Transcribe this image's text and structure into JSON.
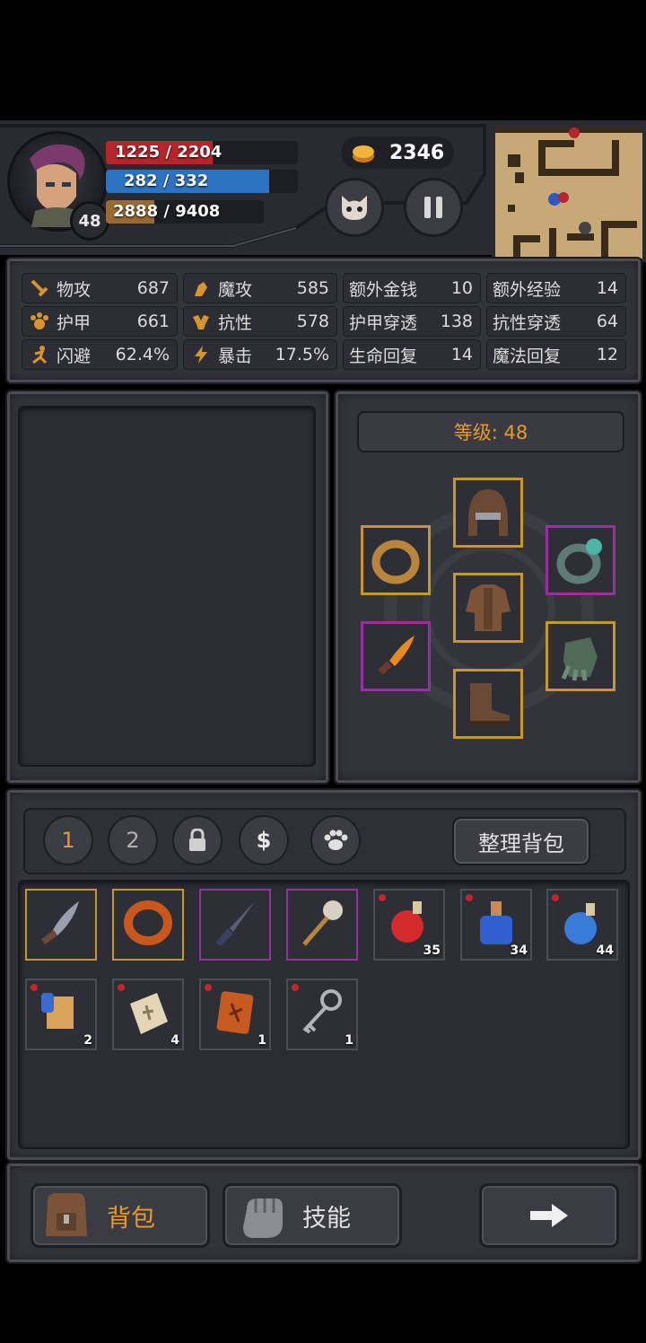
{
  "player": {
    "level": "48",
    "hp": "1225 / 2204",
    "hp_fill": 0.556,
    "mp": "282 / 332",
    "mp_fill": 0.849,
    "xp": "2888 / 9408",
    "xp_fill": 0.307
  },
  "gold": "2346",
  "stats": [
    {
      "icon": "sword-icon",
      "label": "物攻",
      "value": "687"
    },
    {
      "icon": "magic-hand-icon",
      "label": "魔攻",
      "value": "585"
    },
    {
      "icon": "",
      "label": "额外金钱",
      "value": "10"
    },
    {
      "icon": "",
      "label": "额外经验",
      "value": "14"
    },
    {
      "icon": "paw-armor-icon",
      "label": "护甲",
      "value": "661"
    },
    {
      "icon": "muscle-icon",
      "label": "抗性",
      "value": "578"
    },
    {
      "icon": "",
      "label": "护甲穿透",
      "value": "138"
    },
    {
      "icon": "",
      "label": "抗性穿透",
      "value": "64"
    },
    {
      "icon": "runner-icon",
      "label": "闪避",
      "value": "62.4%"
    },
    {
      "icon": "lightning-icon",
      "label": "暴击",
      "value": "17.5%"
    },
    {
      "icon": "",
      "label": "生命回复",
      "value": "14"
    },
    {
      "icon": "",
      "label": "魔法回复",
      "value": "12"
    }
  ],
  "equip": {
    "level_label": "等级: 48"
  },
  "bag": {
    "tabs": [
      "1",
      "2"
    ],
    "sort_label": "整理背包",
    "items": [
      {
        "name": "curved-dagger",
        "rarity": "gold",
        "count": ""
      },
      {
        "name": "fire-ring",
        "rarity": "gold",
        "count": ""
      },
      {
        "name": "dark-dagger",
        "rarity": "epic",
        "count": ""
      },
      {
        "name": "skull-staff",
        "rarity": "epic",
        "count": ""
      },
      {
        "name": "red-potion",
        "rarity": "common",
        "count": "35"
      },
      {
        "name": "blue-potion-square",
        "rarity": "common",
        "count": "34"
      },
      {
        "name": "blue-potion-round",
        "rarity": "common",
        "count": "44"
      },
      {
        "name": "scroll",
        "rarity": "common",
        "count": "2"
      },
      {
        "name": "rune-stone",
        "rarity": "common",
        "count": "4"
      },
      {
        "name": "rune-tablet",
        "rarity": "common",
        "count": "1"
      },
      {
        "name": "key",
        "rarity": "common",
        "count": "1"
      }
    ]
  },
  "nav": {
    "bag_label": "背包",
    "skills_label": "技能"
  },
  "colors": {
    "accent": "#e89a2c",
    "hp": "#b8242b",
    "mp": "#2c73c2",
    "xp": "#9a6a33",
    "gold_border": "#c9962c",
    "epic_border": "#9a2fa4"
  }
}
